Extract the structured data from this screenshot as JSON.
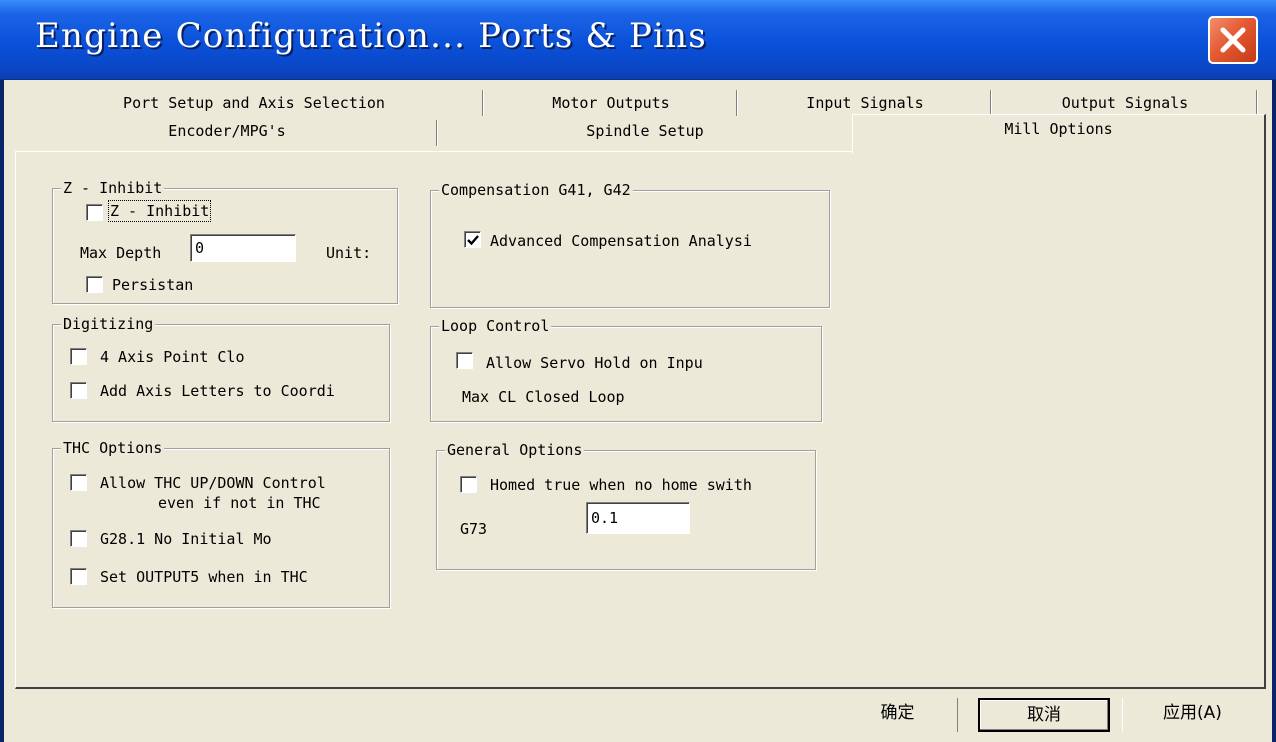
{
  "window": {
    "title": "Engine Configuration... Ports & Pins"
  },
  "tabs": {
    "row1": [
      {
        "label": "Port Setup and Axis Selection"
      },
      {
        "label": "Motor Outputs"
      },
      {
        "label": "Input Signals"
      },
      {
        "label": "Output Signals"
      }
    ],
    "row2": [
      {
        "label": "Encoder/MPG's"
      },
      {
        "label": "Spindle Setup"
      },
      {
        "label": "Mill Options",
        "selected": true
      }
    ]
  },
  "z_inhibit": {
    "title": "Z - Inhibit",
    "enable_label": "Z - Inhibit",
    "enable_checked": false,
    "max_depth_label": "Max Depth",
    "max_depth_value": "0",
    "units_label": "Unit:",
    "persistent_label": "Persistan",
    "persistent_checked": false
  },
  "compensation": {
    "title": "Compensation G41, G42",
    "advanced_label": "Advanced Compensation Analysi",
    "advanced_checked": true
  },
  "digitizing": {
    "title": "Digitizing",
    "point_cloud_label": "4 Axis Point Clo",
    "point_cloud_checked": false,
    "axis_letters_label": "Add Axis Letters to Coordi",
    "axis_letters_checked": false
  },
  "loop_control": {
    "title": "Loop Control",
    "servo_hold_label": "Allow Servo Hold on Inpu",
    "servo_hold_checked": false,
    "max_cl_label": "Max CL Closed Loop"
  },
  "thc_options": {
    "title": "THC Options",
    "updown_label_line1": "Allow THC UP/DOWN Control",
    "updown_label_line2": "even if not in THC",
    "updown_checked": false,
    "g28_label": "G28.1 No Initial Mo",
    "g28_checked": false,
    "output5_label": "Set OUTPUT5 when in THC",
    "output5_checked": false
  },
  "general_options": {
    "title": "General Options",
    "homed_label": "Homed true when no home swith",
    "homed_checked": false,
    "g73_label": "G73",
    "g73_value": "0.1"
  },
  "buttons": {
    "ok": "确定",
    "cancel": "取消",
    "apply": "应用(A)"
  },
  "colors": {
    "titlebar": "#0a51d9",
    "dialog_bg": "#ece9d8",
    "close_button": "#e55a32"
  }
}
